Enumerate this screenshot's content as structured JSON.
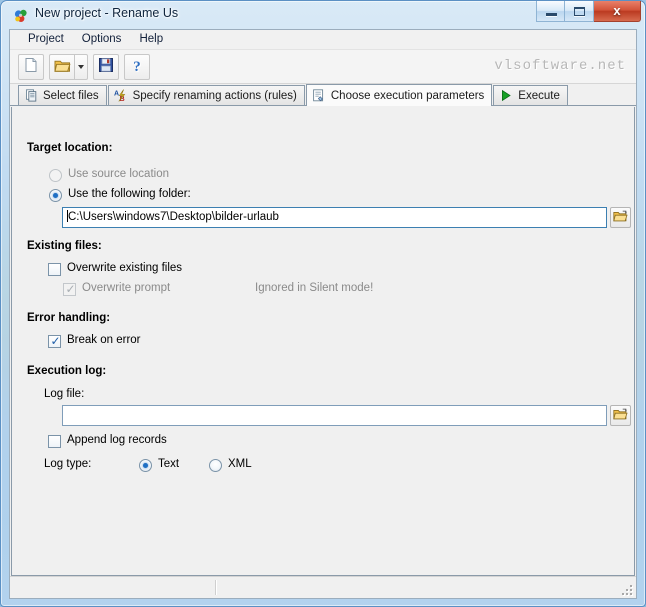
{
  "window": {
    "title": "New project - Rename Us",
    "icon": "app-icon",
    "buttons": {
      "minimize": "–",
      "maximize": "□",
      "close": "x"
    }
  },
  "menubar": {
    "items": [
      {
        "label": "Project"
      },
      {
        "label": "Options"
      },
      {
        "label": "Help"
      }
    ]
  },
  "toolbar": {
    "buttons": [
      {
        "name": "new-project-button",
        "icon": "new-document-icon"
      },
      {
        "name": "open-project-button",
        "icon": "open-folder-icon",
        "has_dropdown": true
      },
      {
        "name": "save-project-button",
        "icon": "floppy-disk-icon"
      },
      {
        "name": "help-button",
        "icon": "question-mark-icon"
      }
    ],
    "watermark": "vlsoftware.net"
  },
  "tabs": [
    {
      "label": "Select files",
      "icon": "files-icon",
      "active": false
    },
    {
      "label": "Specify renaming actions (rules)",
      "icon": "ab-rules-icon",
      "active": false
    },
    {
      "label": "Choose execution parameters",
      "icon": "parameters-icon",
      "active": true
    },
    {
      "label": "Execute",
      "icon": "play-icon",
      "active": false
    }
  ],
  "page": {
    "target_location": {
      "heading": "Target location:",
      "radio_source": {
        "label": "Use source location",
        "checked": false,
        "disabled": true
      },
      "radio_folder": {
        "label": "Use the following folder:",
        "checked": true,
        "disabled": false
      },
      "folder_path": "C:\\Users\\windows7\\Desktop\\bilder-urlaub",
      "browse_icon": "open-folder-icon"
    },
    "existing_files": {
      "heading": "Existing files:",
      "overwrite_existing": {
        "label": "Overwrite existing files",
        "checked": false,
        "disabled": false
      },
      "overwrite_prompt": {
        "label": "Overwrite prompt",
        "checked": true,
        "disabled": true
      },
      "silent_note": "Ignored in Silent mode!"
    },
    "error_handling": {
      "heading": "Error handling:",
      "break_on_error": {
        "label": "Break on error",
        "checked": true,
        "disabled": false
      }
    },
    "execution_log": {
      "heading": "Execution log:",
      "log_file_label": "Log file:",
      "log_file_value": "",
      "browse_icon": "open-folder-icon",
      "append_log": {
        "label": "Append log records",
        "checked": false,
        "disabled": false
      },
      "log_type_label": "Log type:",
      "log_type_options": [
        {
          "label": "Text",
          "checked": true
        },
        {
          "label": "XML",
          "checked": false
        }
      ]
    }
  },
  "statusbar": {
    "left_panel": "",
    "right_panel": ""
  },
  "colors": {
    "accent_blue": "#1f6fc4",
    "frame_blue": "#5b90c4",
    "close_red": "#bb3a21",
    "watermark_gray": "#b7b7b7"
  }
}
